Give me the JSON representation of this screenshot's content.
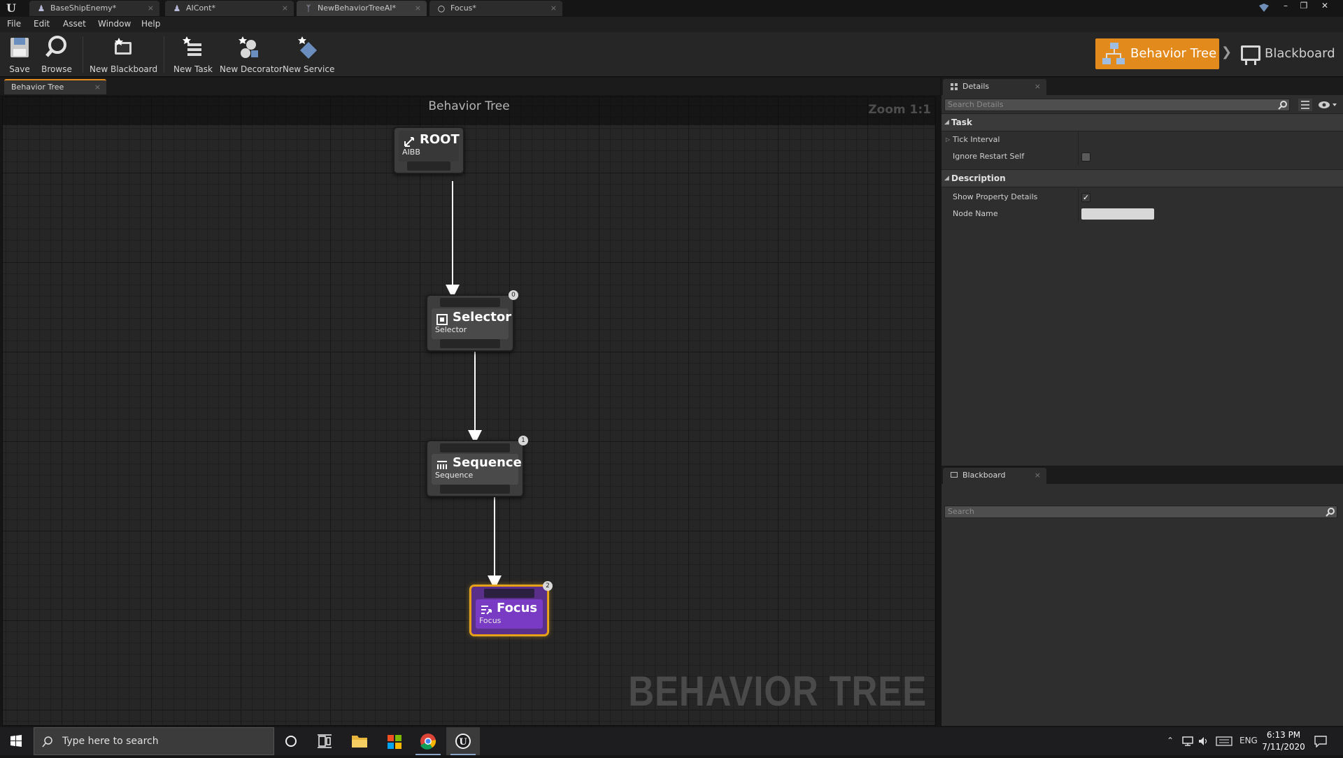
{
  "window": {
    "tabs": [
      {
        "label": "BaseShipEnemy*",
        "icon": "blueprint-icon"
      },
      {
        "label": "AICont*",
        "icon": "blueprint-icon"
      },
      {
        "label": "NewBehaviorTreeAI*",
        "icon": "behavior-tree-icon"
      },
      {
        "label": "Focus*",
        "icon": "task-icon"
      }
    ],
    "controls": [
      "minimize",
      "maximize",
      "close"
    ]
  },
  "menu": [
    "File",
    "Edit",
    "Asset",
    "Window",
    "Help"
  ],
  "toolbar": {
    "buttons": [
      {
        "label": "Save",
        "icon": "save-icon"
      },
      {
        "label": "Browse",
        "icon": "browse-icon"
      },
      {
        "label": "New Blackboard",
        "icon": "new-blackboard-icon"
      },
      {
        "label": "New Task",
        "icon": "new-task-icon"
      },
      {
        "label": "New Decorator",
        "icon": "new-decorator-icon"
      },
      {
        "label": "New Service",
        "icon": "new-service-icon"
      }
    ],
    "modes": {
      "behavior_tree": "Behavior Tree",
      "blackboard": "Blackboard",
      "active": "Behavior Tree",
      "accent_color": "#e38a1c"
    }
  },
  "graph": {
    "tab_label": "Behavior Tree",
    "title": "Behavior Tree",
    "zoom": "Zoom 1:1",
    "watermark": "BEHAVIOR TREE",
    "nodes": [
      {
        "id": "root",
        "title": "ROOT",
        "subtitle": "AIBB",
        "icon": "root-icon"
      },
      {
        "id": "selector",
        "title": "Selector",
        "subtitle": "Selector",
        "icon": "selector-icon",
        "index": "0"
      },
      {
        "id": "sequence",
        "title": "Sequence",
        "subtitle": "Sequence",
        "icon": "sequence-icon",
        "index": "1"
      },
      {
        "id": "focus",
        "title": "Focus",
        "subtitle": "Focus",
        "icon": "task-icon",
        "index": "2",
        "selected": true,
        "color": "#7a3bc4",
        "highlight": "#e39a17"
      }
    ]
  },
  "details": {
    "tab_label": "Details",
    "search_placeholder": "Search Details",
    "categories": [
      {
        "name": "Task",
        "rows": [
          {
            "label": "Tick Interval",
            "type": "expandable"
          },
          {
            "label": "Ignore Restart Self",
            "type": "checkbox",
            "checked": false
          }
        ]
      },
      {
        "name": "Description",
        "rows": [
          {
            "label": "Show Property Details",
            "type": "checkbox",
            "checked": true
          },
          {
            "label": "Node Name",
            "type": "text",
            "value": ""
          }
        ]
      }
    ]
  },
  "blackboard": {
    "tab_label": "Blackboard",
    "search_placeholder": "Search"
  },
  "taskbar": {
    "search_placeholder": "Type here to search",
    "apps": [
      "cortana-icon",
      "task-view-icon",
      "file-explorer-icon",
      "store-icon",
      "chrome-icon",
      "unreal-engine-icon"
    ],
    "language": "ENG",
    "time": "6:13 PM",
    "date": "7/11/2020"
  }
}
